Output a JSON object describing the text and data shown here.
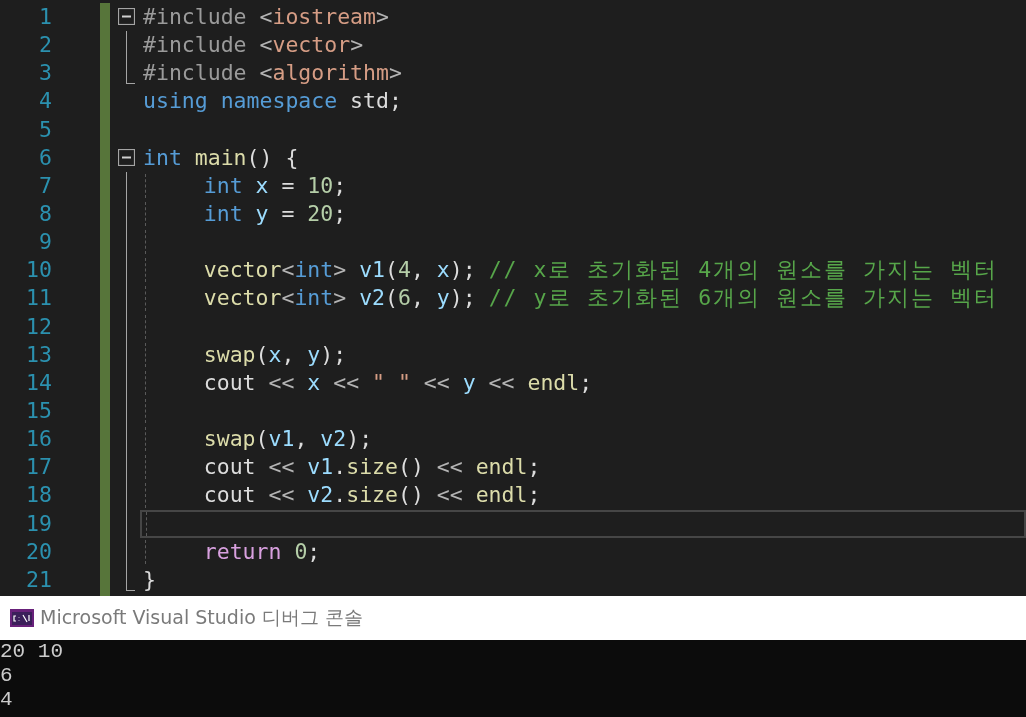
{
  "editor": {
    "lines": [
      {
        "number": "1",
        "kind": "fold-start",
        "selected": false,
        "tokens": [
          {
            "t": "#include ",
            "kind": "pre"
          },
          {
            "t": "<",
            "kind": "punct"
          },
          {
            "t": "iostream",
            "kind": "str"
          },
          {
            "t": ">",
            "kind": "punct"
          }
        ]
      },
      {
        "number": "2",
        "kind": "fold-inner",
        "selected": false,
        "tokens": [
          {
            "t": "#include ",
            "kind": "pre"
          },
          {
            "t": "<",
            "kind": "punct"
          },
          {
            "t": "vector",
            "kind": "str"
          },
          {
            "t": ">",
            "kind": "punct"
          }
        ]
      },
      {
        "number": "3",
        "kind": "fold-end",
        "selected": false,
        "tokens": [
          {
            "t": "#include ",
            "kind": "pre"
          },
          {
            "t": "<",
            "kind": "punct"
          },
          {
            "t": "algorithm",
            "kind": "str"
          },
          {
            "t": ">",
            "kind": "punct"
          }
        ]
      },
      {
        "number": "4",
        "kind": "plain",
        "selected": false,
        "tokens": [
          {
            "t": "using ",
            "kind": "kw"
          },
          {
            "t": "namespace",
            "kind": "kw"
          },
          {
            "t": " std;",
            "kind": "plain"
          }
        ]
      },
      {
        "number": "5",
        "kind": "plain",
        "selected": false
      },
      {
        "number": "6",
        "kind": "fold-start",
        "selected": false,
        "tokens": [
          {
            "t": "int ",
            "kind": "kw"
          },
          {
            "t": "main",
            "kind": "func"
          },
          {
            "t": "() {",
            "kind": "plain"
          }
        ]
      },
      {
        "number": "7",
        "kind": "fold-body",
        "selected": false,
        "tokens": [
          {
            "t": "    int ",
            "kind": "kw"
          },
          {
            "t": "x",
            "kind": "var"
          },
          {
            "t": " = ",
            "kind": "plain"
          },
          {
            "t": "10",
            "kind": "num"
          },
          {
            "t": ";",
            "kind": "plain"
          }
        ]
      },
      {
        "number": "8",
        "kind": "fold-body",
        "selected": false,
        "tokens": [
          {
            "t": "    int ",
            "kind": "kw"
          },
          {
            "t": "y",
            "kind": "var"
          },
          {
            "t": " = ",
            "kind": "plain"
          },
          {
            "t": "20",
            "kind": "num"
          },
          {
            "t": ";",
            "kind": "plain"
          }
        ]
      },
      {
        "number": "9",
        "kind": "fold-body",
        "selected": false
      },
      {
        "number": "10",
        "kind": "fold-body",
        "selected": false,
        "tokens": [
          {
            "t": "    vector",
            "kind": "func"
          },
          {
            "t": "<",
            "kind": "punct"
          },
          {
            "t": "int",
            "kind": "kw"
          },
          {
            "t": "> ",
            "kind": "punct"
          },
          {
            "t": "v1",
            "kind": "var"
          },
          {
            "t": "(",
            "kind": "plain"
          },
          {
            "t": "4",
            "kind": "num"
          },
          {
            "t": ", ",
            "kind": "plain"
          },
          {
            "t": "x",
            "kind": "var"
          },
          {
            "t": "); ",
            "kind": "plain"
          },
          {
            "t": "// x로 초기화된 4개의 원소를 가지는 벡터",
            "kind": "comment"
          }
        ]
      },
      {
        "number": "11",
        "kind": "fold-body",
        "selected": false,
        "tokens": [
          {
            "t": "    vector",
            "kind": "func"
          },
          {
            "t": "<",
            "kind": "punct"
          },
          {
            "t": "int",
            "kind": "kw"
          },
          {
            "t": "> ",
            "kind": "punct"
          },
          {
            "t": "v2",
            "kind": "var"
          },
          {
            "t": "(",
            "kind": "plain"
          },
          {
            "t": "6",
            "kind": "num"
          },
          {
            "t": ", ",
            "kind": "plain"
          },
          {
            "t": "y",
            "kind": "var"
          },
          {
            "t": "); ",
            "kind": "plain"
          },
          {
            "t": "// y로 초기화된 6개의 원소를 가지는 벡터",
            "kind": "comment"
          }
        ]
      },
      {
        "number": "12",
        "kind": "fold-body",
        "selected": false
      },
      {
        "number": "13",
        "kind": "fold-body",
        "selected": false,
        "tokens": [
          {
            "t": "    swap",
            "kind": "func"
          },
          {
            "t": "(",
            "kind": "plain"
          },
          {
            "t": "x",
            "kind": "var"
          },
          {
            "t": ", ",
            "kind": "plain"
          },
          {
            "t": "y",
            "kind": "var"
          },
          {
            "t": ");",
            "kind": "plain"
          }
        ]
      },
      {
        "number": "14",
        "kind": "fold-body",
        "selected": false,
        "tokens": [
          {
            "t": "    cout",
            "kind": "plain"
          },
          {
            "t": " << ",
            "kind": "punct"
          },
          {
            "t": "x",
            "kind": "var"
          },
          {
            "t": " << ",
            "kind": "punct"
          },
          {
            "t": "\" \"",
            "kind": "str"
          },
          {
            "t": " << ",
            "kind": "punct"
          },
          {
            "t": "y",
            "kind": "var"
          },
          {
            "t": " << ",
            "kind": "punct"
          },
          {
            "t": "endl",
            "kind": "func"
          },
          {
            "t": ";",
            "kind": "plain"
          }
        ]
      },
      {
        "number": "15",
        "kind": "fold-body",
        "selected": false
      },
      {
        "number": "16",
        "kind": "fold-body",
        "selected": false,
        "tokens": [
          {
            "t": "    swap",
            "kind": "func"
          },
          {
            "t": "(",
            "kind": "plain"
          },
          {
            "t": "v1",
            "kind": "var"
          },
          {
            "t": ", ",
            "kind": "plain"
          },
          {
            "t": "v2",
            "kind": "var"
          },
          {
            "t": ");",
            "kind": "plain"
          }
        ]
      },
      {
        "number": "17",
        "kind": "fold-body",
        "selected": false,
        "tokens": [
          {
            "t": "    cout",
            "kind": "plain"
          },
          {
            "t": " << ",
            "kind": "punct"
          },
          {
            "t": "v1",
            "kind": "var"
          },
          {
            "t": ".",
            "kind": "plain"
          },
          {
            "t": "size",
            "kind": "func"
          },
          {
            "t": "()",
            "kind": "plain"
          },
          {
            "t": " << ",
            "kind": "punct"
          },
          {
            "t": "endl",
            "kind": "func"
          },
          {
            "t": ";",
            "kind": "plain"
          }
        ]
      },
      {
        "number": "18",
        "kind": "fold-body",
        "selected": false,
        "tokens": [
          {
            "t": "    cout",
            "kind": "plain"
          },
          {
            "t": " << ",
            "kind": "punct"
          },
          {
            "t": "v2",
            "kind": "var"
          },
          {
            "t": ".",
            "kind": "plain"
          },
          {
            "t": "size",
            "kind": "func"
          },
          {
            "t": "()",
            "kind": "plain"
          },
          {
            "t": " << ",
            "kind": "punct"
          },
          {
            "t": "endl",
            "kind": "func"
          },
          {
            "t": ";",
            "kind": "plain"
          }
        ]
      },
      {
        "number": "19",
        "kind": "fold-body",
        "selected": true
      },
      {
        "number": "20",
        "kind": "fold-body",
        "selected": false,
        "tokens": [
          {
            "t": "    return ",
            "kind": "ctrl"
          },
          {
            "t": "0",
            "kind": "num"
          },
          {
            "t": ";",
            "kind": "plain"
          }
        ]
      },
      {
        "number": "21",
        "kind": "fold-end",
        "selected": false,
        "tokens": [
          {
            "t": "}",
            "kind": "plain"
          }
        ]
      }
    ]
  },
  "console": {
    "title": "Microsoft Visual Studio 디버그 콘솔",
    "output": [
      "20 10",
      "6",
      "4"
    ]
  }
}
